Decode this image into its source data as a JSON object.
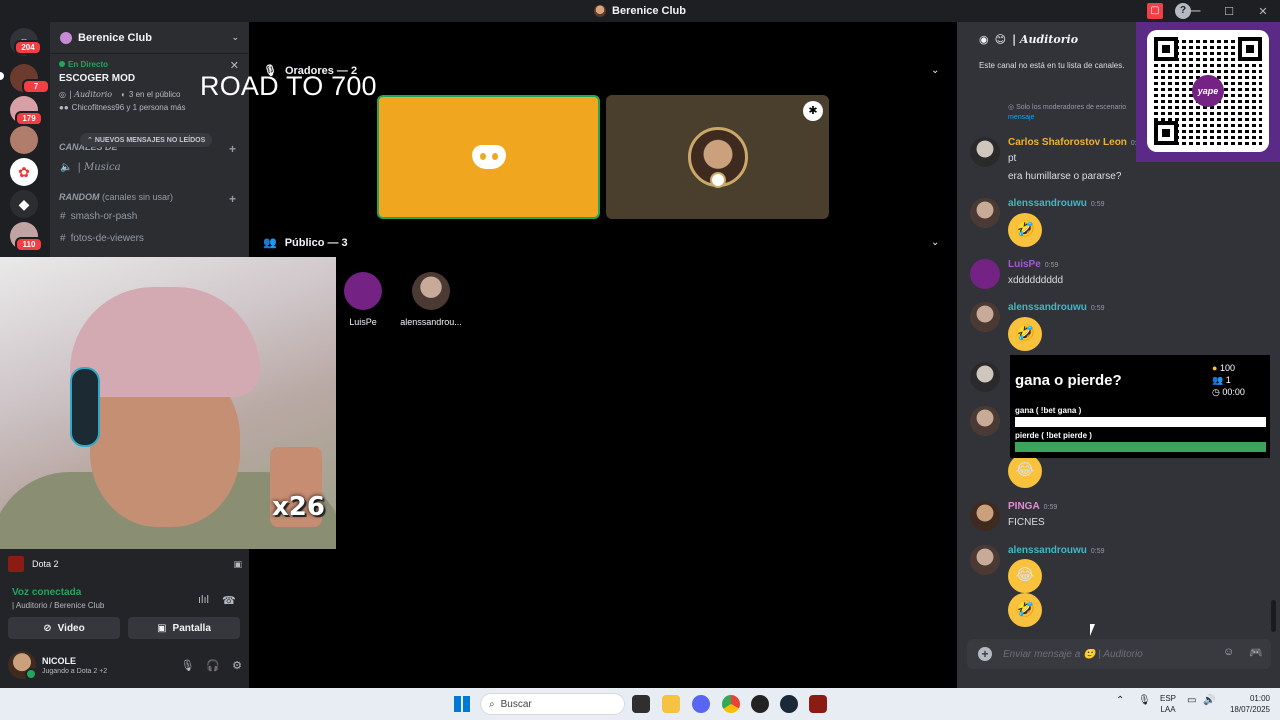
{
  "window": {
    "title": "Berenice Club"
  },
  "rail": {
    "badges": [
      "204",
      "7",
      "179",
      "110"
    ]
  },
  "sidebar": {
    "server_name": "Berenice Club",
    "live_label": "En Directo",
    "stage_title": "ESCOGER MOD",
    "stage_channel": "| Auditorio",
    "public_count": "3 en el público",
    "participants": "Chicofitness96 y 1 persona más",
    "unread_pill": "NUEVOS MENSAJES NO LEÍDOS",
    "category1": "CANALES DE",
    "channel_musica": "| Musica",
    "category2": "RANDOM",
    "category2_note": "(canales sin usar)",
    "channels": [
      "smash-or-pash",
      "fotos-de-viewers"
    ]
  },
  "overlay": {
    "road_text": "ROAD TO 700",
    "combo": "x26"
  },
  "bottom": {
    "game": "Dota 2",
    "voice_status": "Voz conectada",
    "voice_location": "| Auditorio / Berenice Club",
    "video_btn": "Video",
    "screen_btn": "Pantalla",
    "user_name": "NICOLE",
    "user_activity": "Jugando a Dota 2 +2"
  },
  "stage": {
    "speakers_title": "Oradores — 2",
    "public_title": "Público — 3",
    "audience": [
      "LuisPe",
      "alenssandrou..."
    ]
  },
  "chat": {
    "channel": "| Auditorio",
    "notice": "Este canal no está en tu lista de canales.",
    "mod_note": "Solo los moderadores de escenario",
    "mod_link": "mensaje",
    "messages": [
      {
        "author": "Carlos Shaforostov Leon",
        "time": "0:5",
        "lines": [
          "pt",
          "era humillarse o pararse?"
        ],
        "color": "#f0b232"
      },
      {
        "author": "alenssandrouwu",
        "time": "0:59",
        "color": "#3fb9c6"
      },
      {
        "author": "LuisPe",
        "time": "0:59",
        "lines": [
          "xddddddddd"
        ],
        "color": "#a35bd1"
      },
      {
        "author": "alenssandrouwu",
        "time": "0:59",
        "color": "#3fb9c6"
      },
      {
        "author": "PINGA",
        "time": "0:59",
        "lines": [
          "FICNES"
        ],
        "color": "#e28bd6"
      },
      {
        "author": "alenssandrouwu",
        "time": "0:59",
        "color": "#3fb9c6"
      }
    ],
    "input_placeholder": "Enviar mensaje a 🙂 | Auditorio"
  },
  "bet": {
    "question": "gana o pierde?",
    "coins": "100",
    "users": "1",
    "timer": "00:00",
    "option1": "gana ( !bet gana )",
    "option2": "pierde ( !bet pierde )",
    "option1_share": 0,
    "option2_share": 1
  },
  "qr": {
    "logo_text": "yape"
  },
  "taskbar": {
    "search_placeholder": "Buscar",
    "lang_top": "ESP",
    "lang_bottom": "LAA",
    "time": "01:00",
    "date": "18/07/2025"
  },
  "colors": {
    "accent": "#5865f2",
    "online": "#23a55a",
    "stage_tile": "#f0a61f",
    "qr_bg": "#5b2a86"
  }
}
